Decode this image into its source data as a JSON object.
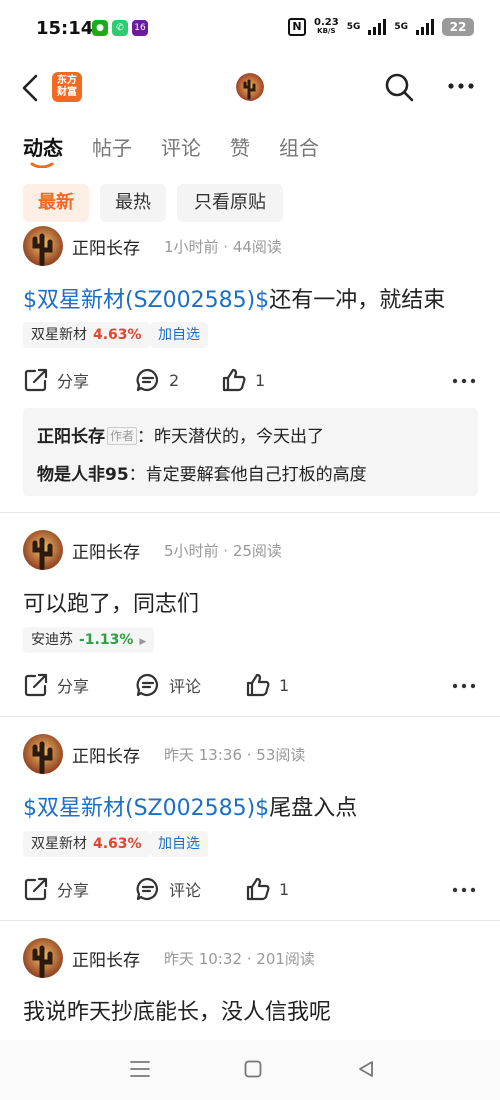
{
  "status": {
    "time": "15:14",
    "apps": [
      {
        "name": "wechat-icon",
        "color": "#1aad19",
        "glyph": "●"
      },
      {
        "name": "phone-icon",
        "color": "#2ecc71",
        "glyph": "✆"
      },
      {
        "name": "app-icon",
        "color": "#6a1b9a",
        "glyph": "16"
      }
    ],
    "speed": "0.23",
    "speed_unit": "KB/S",
    "net1": "5G",
    "net2": "5G",
    "battery": "22"
  },
  "header": {
    "logo_text": "东方财富"
  },
  "tabs": [
    {
      "label": "动态",
      "active": true
    },
    {
      "label": "帖子",
      "active": false
    },
    {
      "label": "评论",
      "active": false
    },
    {
      "label": "赞",
      "active": false
    },
    {
      "label": "组合",
      "active": false
    }
  ],
  "filters": [
    {
      "label": "最新",
      "active": true
    },
    {
      "label": "最热",
      "active": false
    },
    {
      "label": "只看原贴",
      "active": false
    }
  ],
  "colors": {
    "accent": "#f26a21",
    "stock_link": "#1c6fc9",
    "up": "#e1462e",
    "down": "#2ea043"
  },
  "posts": [
    {
      "author": "正阳长存",
      "meta": "1小时前 · 44阅读",
      "stock_link": "$双星新材(SZ002585)$",
      "text": "还有一冲，就结束",
      "tag_name": "双星新材",
      "tag_pct": "4.63%",
      "add_fav": "加自选",
      "share": "分享",
      "comment": "2",
      "like": "1",
      "comments": [
        {
          "user": "正阳长存",
          "badge": "作者",
          "text": "：昨天潜伏的，今天出了"
        },
        {
          "user": "物是人非95",
          "text": "：肯定要解套他自己打板的高度"
        }
      ]
    },
    {
      "author": "正阳长存",
      "meta": "5小时前 · 25阅读",
      "text": "可以跑了，同志们",
      "tag_name": "安迪苏",
      "tag_pct": "-1.13%",
      "share": "分享",
      "comment": "评论",
      "like": "1"
    },
    {
      "author": "正阳长存",
      "meta": "昨天 13:36 · 53阅读",
      "stock_link": "$双星新材(SZ002585)$",
      "text": "尾盘入点",
      "tag_name": "双星新材",
      "tag_pct": "4.63%",
      "add_fav": "加自选",
      "share": "分享",
      "comment": "评论",
      "like": "1"
    },
    {
      "author": "正阳长存",
      "meta": "昨天 10:32 · 201阅读",
      "text": "我说昨天抄底能长，没人信我呢"
    }
  ]
}
